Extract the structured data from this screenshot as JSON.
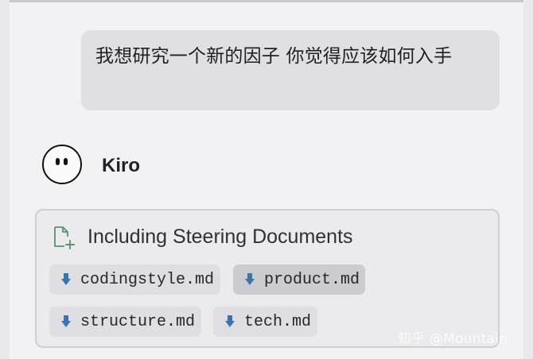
{
  "chat": {
    "user_message": "我想研究一个新的因子 你觉得应该如何入手",
    "agent_name": "Kiro"
  },
  "steering": {
    "title": "Including Steering Documents",
    "icon": "document-plus-icon",
    "documents": [
      {
        "label": "codingstyle.md",
        "icon": "download-arrow-icon"
      },
      {
        "label": "product.md",
        "icon": "download-arrow-icon",
        "highlighted": true
      },
      {
        "label": "structure.md",
        "icon": "download-arrow-icon"
      },
      {
        "label": "tech.md",
        "icon": "download-arrow-icon"
      }
    ]
  },
  "watermark": {
    "text": "知乎 @Mountain"
  },
  "colors": {
    "page_bg": "#e9e8ec",
    "panel_bg": "#f2f2f4",
    "bubble_bg": "#e0dfe4",
    "chip_bg": "#dfdfe3",
    "chip_active_bg": "#cbcbd0",
    "icon_blue": "#3b74a8",
    "icon_green": "#5f8f6f"
  }
}
